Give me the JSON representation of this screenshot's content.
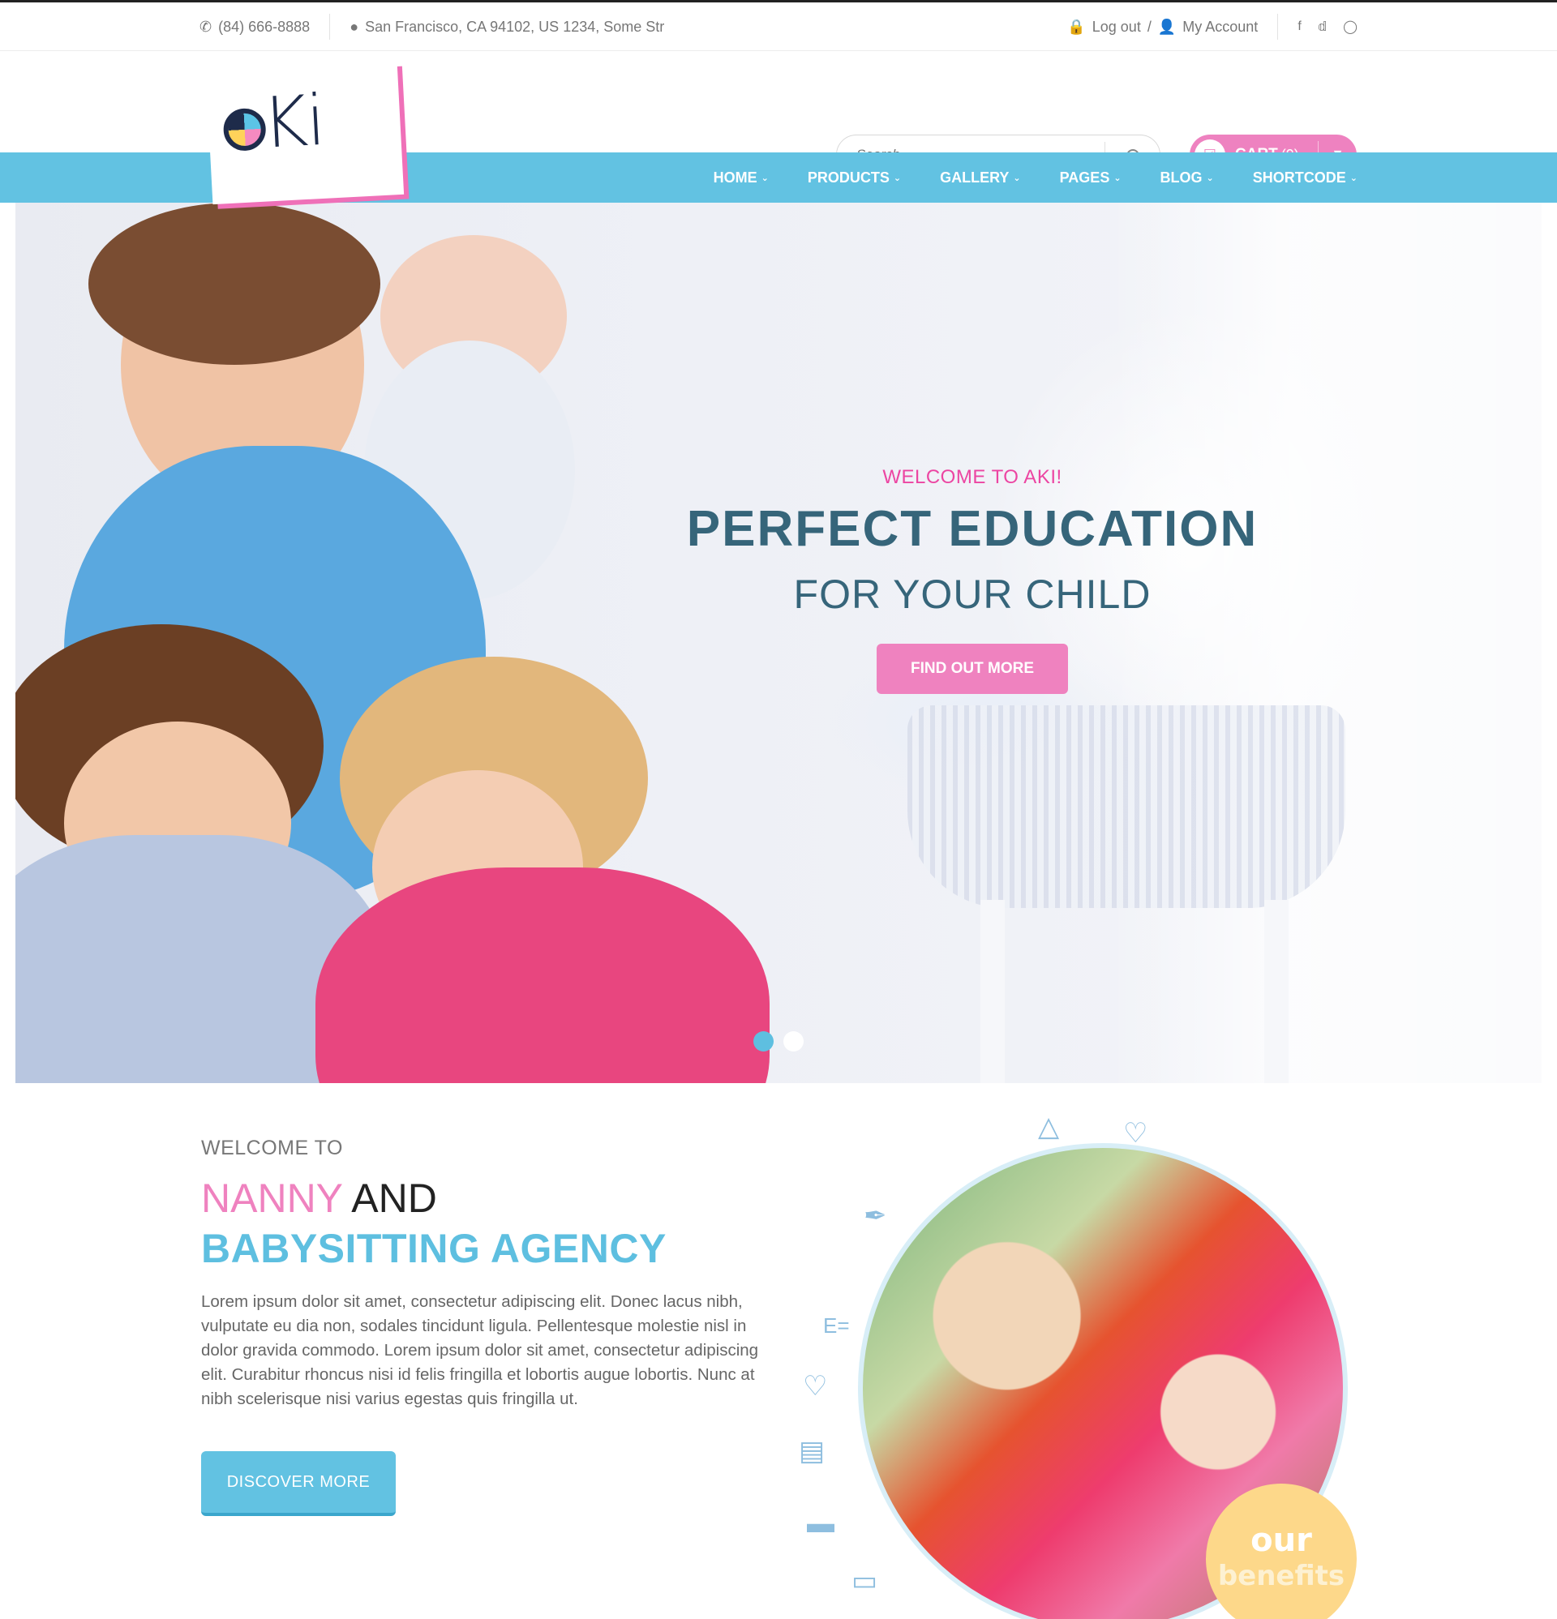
{
  "topbar": {
    "phone": "(84) 666-8888",
    "address": "San Francisco, CA 94102, US 1234, Some Str",
    "logout": "Log out",
    "divider": "/",
    "account": "My Account",
    "social": [
      "facebook-icon",
      "twitter-icon",
      "instagram-icon"
    ]
  },
  "header": {
    "logo": "aKi",
    "search_placeholder": "Search...",
    "cart_label": "CART",
    "cart_count": "(9)"
  },
  "nav": [
    "HOME",
    "PRODUCTS",
    "GALLERY",
    "PAGES",
    "BLOG",
    "SHORTCODE"
  ],
  "hero": {
    "welcome": "WELCOME TO AKI!",
    "title": "PERFECT EDUCATION",
    "subtitle": "FOR YOUR CHILD",
    "button": "FIND OUT MORE",
    "slides": 2,
    "active_slide": 1
  },
  "about": {
    "welcome": "WELCOME TO",
    "h1_pink": "NANNY",
    "h1_rest": "AND",
    "h2": "BABYSITTING AGENCY",
    "body": "Lorem ipsum dolor sit amet, consectetur adipiscing elit. Donec lacus nibh, vulputate eu dia non, sodales tincidunt ligula. Pellentesque molestie nisl in dolor gravida commodo. Lorem ipsum dolor sit amet, consectetur adipiscing elit. Curabitur rhoncus nisi id felis fringilla et lobortis augue lobortis. Nunc at nibh scelerisque nisi varius egestas quis fringilla ut.",
    "button": "DISCOVER MORE"
  },
  "benefits": {
    "line1": "our",
    "line2": "benefits"
  },
  "colors": {
    "pink": "#ef82bf",
    "blue": "#62c2e2",
    "teal": "#36657a",
    "yellow": "#fdd88a"
  }
}
